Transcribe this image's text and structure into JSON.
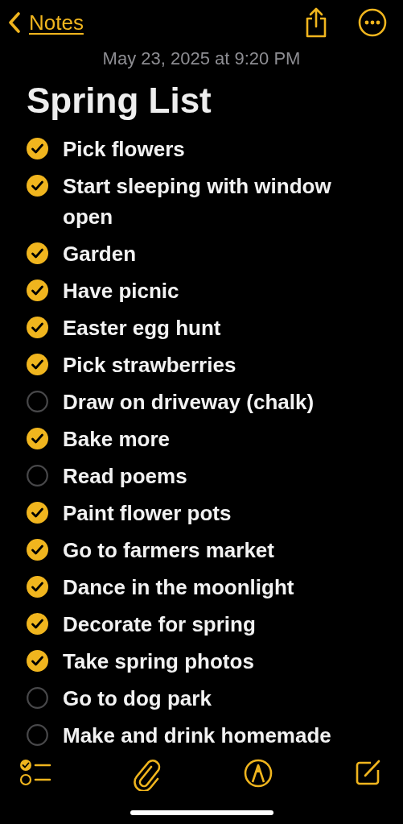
{
  "nav": {
    "back_label": "Notes"
  },
  "note": {
    "date": "May 23, 2025 at 9:20 PM",
    "title": "Spring List",
    "items": [
      {
        "text": "Pick flowers",
        "checked": true
      },
      {
        "text": "Start sleeping with window open",
        "checked": true
      },
      {
        "text": "Garden",
        "checked": true
      },
      {
        "text": "Have picnic",
        "checked": true
      },
      {
        "text": "Easter egg hunt",
        "checked": true
      },
      {
        "text": "Pick strawberries",
        "checked": true
      },
      {
        "text": "Draw on driveway (chalk)",
        "checked": false
      },
      {
        "text": "Bake more",
        "checked": true
      },
      {
        "text": "Read poems",
        "checked": false
      },
      {
        "text": "Paint flower pots",
        "checked": true
      },
      {
        "text": "Go to farmers market",
        "checked": true
      },
      {
        "text": "Dance in the moonlight",
        "checked": true
      },
      {
        "text": "Decorate for spring",
        "checked": true
      },
      {
        "text": "Take spring photos",
        "checked": true
      },
      {
        "text": "Go to dog park",
        "checked": false
      },
      {
        "text": "Make and drink homemade",
        "checked": false
      }
    ]
  }
}
